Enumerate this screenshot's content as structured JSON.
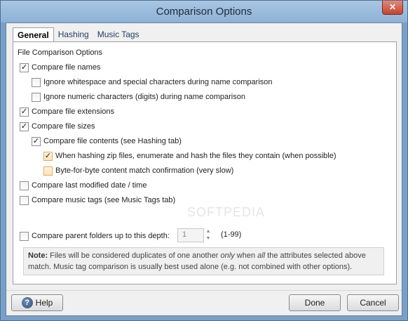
{
  "window": {
    "title": "Comparison Options",
    "close": "✕"
  },
  "tabs": [
    {
      "label": "General",
      "active": true
    },
    {
      "label": "Hashing",
      "active": false
    },
    {
      "label": "Music Tags",
      "active": false
    }
  ],
  "general": {
    "section_title": "File Comparison Options",
    "options": [
      {
        "label": "Compare file names",
        "checked": true
      },
      {
        "label": "Ignore whitespace and special characters during name comparison",
        "checked": false
      },
      {
        "label": "Ignore numeric characters (digits) during name comparison",
        "checked": false
      },
      {
        "label": "Compare file extensions",
        "checked": true
      },
      {
        "label": "Compare file sizes",
        "checked": true
      },
      {
        "label": "Compare file contents (see Hashing tab)",
        "checked": true
      },
      {
        "label": "When hashing zip files, enumerate and hash the files they contain (when possible)",
        "checked": true
      },
      {
        "label": "Byte-for-byte content match confirmation (very slow)",
        "checked": false
      },
      {
        "label": "Compare last modified date / time",
        "checked": false
      },
      {
        "label": "Compare music tags (see Music Tags tab)",
        "checked": false
      },
      {
        "label": "Compare parent folders up to this depth:",
        "checked": false
      }
    ],
    "depth_value": "1",
    "depth_range": "(1-99)",
    "note": {
      "label": "Note:",
      "t1": " Files will be considered duplicates of one another ",
      "em1": "only",
      "t2": " when ",
      "em2": "all",
      "t3": " the attributes selected above match. Music tag comparison is usually best used alone (e.g. not combined with other options)."
    }
  },
  "watermark": "SOFTPEDIA",
  "buttons": {
    "help": "Help",
    "help_icon": "?",
    "done": "Done",
    "cancel": "Cancel"
  }
}
